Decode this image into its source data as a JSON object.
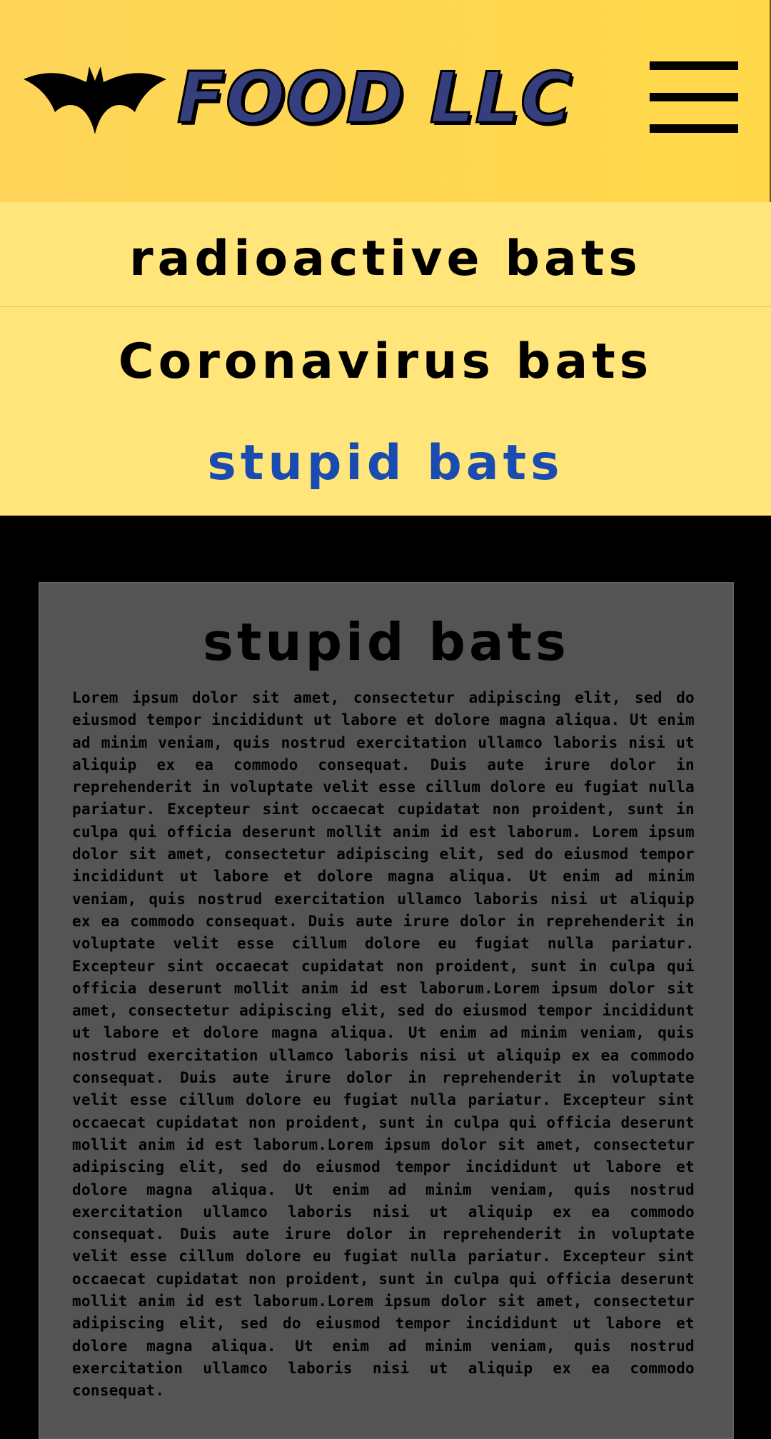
{
  "header": {
    "brand": "FOOD LLC",
    "logo_icon": "bat-logo-icon",
    "menu_icon": "hamburger-menu-icon",
    "background": "#ffd84a"
  },
  "nav": {
    "items": [
      {
        "label": "radioactive bats",
        "active": false
      },
      {
        "label": "Coronavirus bats",
        "active": false
      },
      {
        "label": "stupid bats",
        "active": true
      }
    ],
    "active_color": "#1a4bb0",
    "background": "#ffe57a"
  },
  "card": {
    "title": "stupid bats",
    "body": "Lorem ipsum dolor sit amet, consectetur adipiscing elit, sed do eiusmod tempor incididunt ut labore et dolore magna aliqua. Ut enim ad minim veniam, quis nostrud exercitation ullamco laboris nisi ut aliquip ex ea commodo consequat. Duis aute irure dolor in reprehenderit in voluptate velit esse cillum dolore eu fugiat nulla pariatur. Excepteur sint occaecat cupidatat non proident, sunt in culpa qui officia deserunt mollit anim id est laborum. Lorem ipsum dolor sit amet, consectetur adipiscing elit, sed do eiusmod tempor incididunt ut labore et dolore magna aliqua. Ut enim ad minim veniam, quis nostrud exercitation ullamco laboris nisi ut aliquip ex ea commodo consequat. Duis aute irure dolor in reprehenderit in voluptate velit esse cillum dolore eu fugiat nulla pariatur. Excepteur sint occaecat cupidatat non proident, sunt in culpa qui officia deserunt mollit anim id est laborum.Lorem ipsum dolor sit amet, consectetur adipiscing elit, sed do eiusmod tempor incididunt ut labore et dolore magna aliqua. Ut enim ad minim veniam, quis nostrud exercitation ullamco laboris nisi ut aliquip ex ea commodo consequat. Duis aute irure dolor in reprehenderit in voluptate velit esse cillum dolore eu fugiat nulla pariatur. Excepteur sint occaecat cupidatat non proident, sunt in culpa qui officia deserunt mollit anim id est laborum.Lorem ipsum dolor sit amet, consectetur adipiscing elit, sed do eiusmod tempor incididunt ut labore et dolore magna aliqua. Ut enim ad minim veniam, quis nostrud exercitation ullamco laboris nisi ut aliquip ex ea commodo consequat. Duis aute irure dolor in reprehenderit in voluptate velit esse cillum dolore eu fugiat nulla pariatur. Excepteur sint occaecat cupidatat non proident, sunt in culpa qui officia deserunt mollit anim id est laborum.Lorem ipsum dolor sit amet, consectetur adipiscing elit, sed do eiusmod tempor incididunt ut labore et dolore magna aliqua. Ut enim ad minim veniam, quis nostrud exercitation ullamco laboris nisi ut aliquip ex ea commodo consequat.",
    "background": "#545454"
  },
  "page": {
    "background": "#000000"
  }
}
